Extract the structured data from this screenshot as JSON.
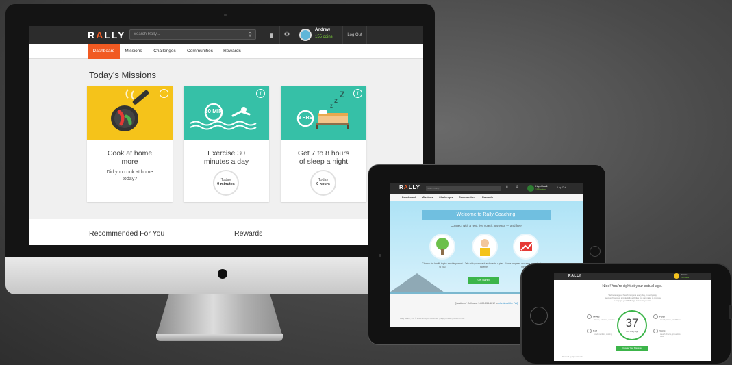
{
  "desktop": {
    "logo": "RALLY",
    "search_placeholder": "Search Rally...",
    "user": {
      "name": "Andrew",
      "coins": "155 coins"
    },
    "logout_label": "Log Out",
    "nav": [
      {
        "label": "Dashboard",
        "active": true
      },
      {
        "label": "Missions"
      },
      {
        "label": "Challenges"
      },
      {
        "label": "Communities"
      },
      {
        "label": "Rewards"
      }
    ],
    "section_title": "Today’s Missions",
    "missions": [
      {
        "title": "Cook at home more",
        "question": "Did you cook at home today?",
        "color": "#f5c31a",
        "icon": "frying-pan-icon"
      },
      {
        "title": "Exercise 30 minutes a day",
        "status_day": "Today",
        "status_value": "0 minutes",
        "color": "#36c0a7",
        "icon": "swimmer-icon",
        "badge": "30 MIN"
      },
      {
        "title": "Get 7 to 8 hours of sleep a night",
        "status_day": "Today",
        "status_value": "0 hours",
        "color": "#36c0a7",
        "icon": "bed-icon",
        "badge": "8 HRS"
      }
    ],
    "recommended_label": "Recommended For You",
    "rewards_label": "Rewards",
    "accent_color": "#f15a22"
  },
  "tablet": {
    "logo": "RALLY",
    "search_placeholder": "Search Rally...",
    "user": {
      "name": "HopeHealth",
      "coins": "155 coins"
    },
    "logout_label": "Log Out",
    "nav": [
      "Dashboard",
      "Missions",
      "Challenges",
      "Communities",
      "Rewards"
    ],
    "banner": "Welcome to Rally Coaching!",
    "subtitle": "Connect with a real, live coach. It's easy — and free.",
    "steps": [
      "Choose the health topics most important to you",
      "Talk with your coach and create a plan together",
      "Make progress and earn rewards along the way"
    ],
    "cta": "Get Started",
    "questions": "Questions? Call us at 1-800-555-1212 or",
    "faq_link": "check out the FAQ",
    "footer": "Rally Health, Inc. © 2014  All Rights Reserved  |  Help  |  Privacy  |  Terms of Use"
  },
  "phone": {
    "logo": "RALLY",
    "user": {
      "name": "Jasmine",
      "coins": "155 coins"
    },
    "headline": "Nice! You're right at your actual age.",
    "body_lines": [
      "We believe good health happens every day, in every way.",
      "Next, we'll suggest simple daily activities you can make to improve",
      "to help get your Rally Age as low as you can."
    ],
    "age": "37",
    "age_label": "Your Rally Age",
    "categories": [
      {
        "label": "Move",
        "desc": "Fitness, activities, exercise"
      },
      {
        "label": "Feel",
        "desc": "Health, stress, mindfulness"
      },
      {
        "label": "Eat",
        "desc": "Food, nutrition, cooking"
      },
      {
        "label": "Care",
        "desc": "Health checks, preventive care"
      }
    ],
    "cta": "Choose Your Missions",
    "footer": "Powered by OptumHealth"
  }
}
